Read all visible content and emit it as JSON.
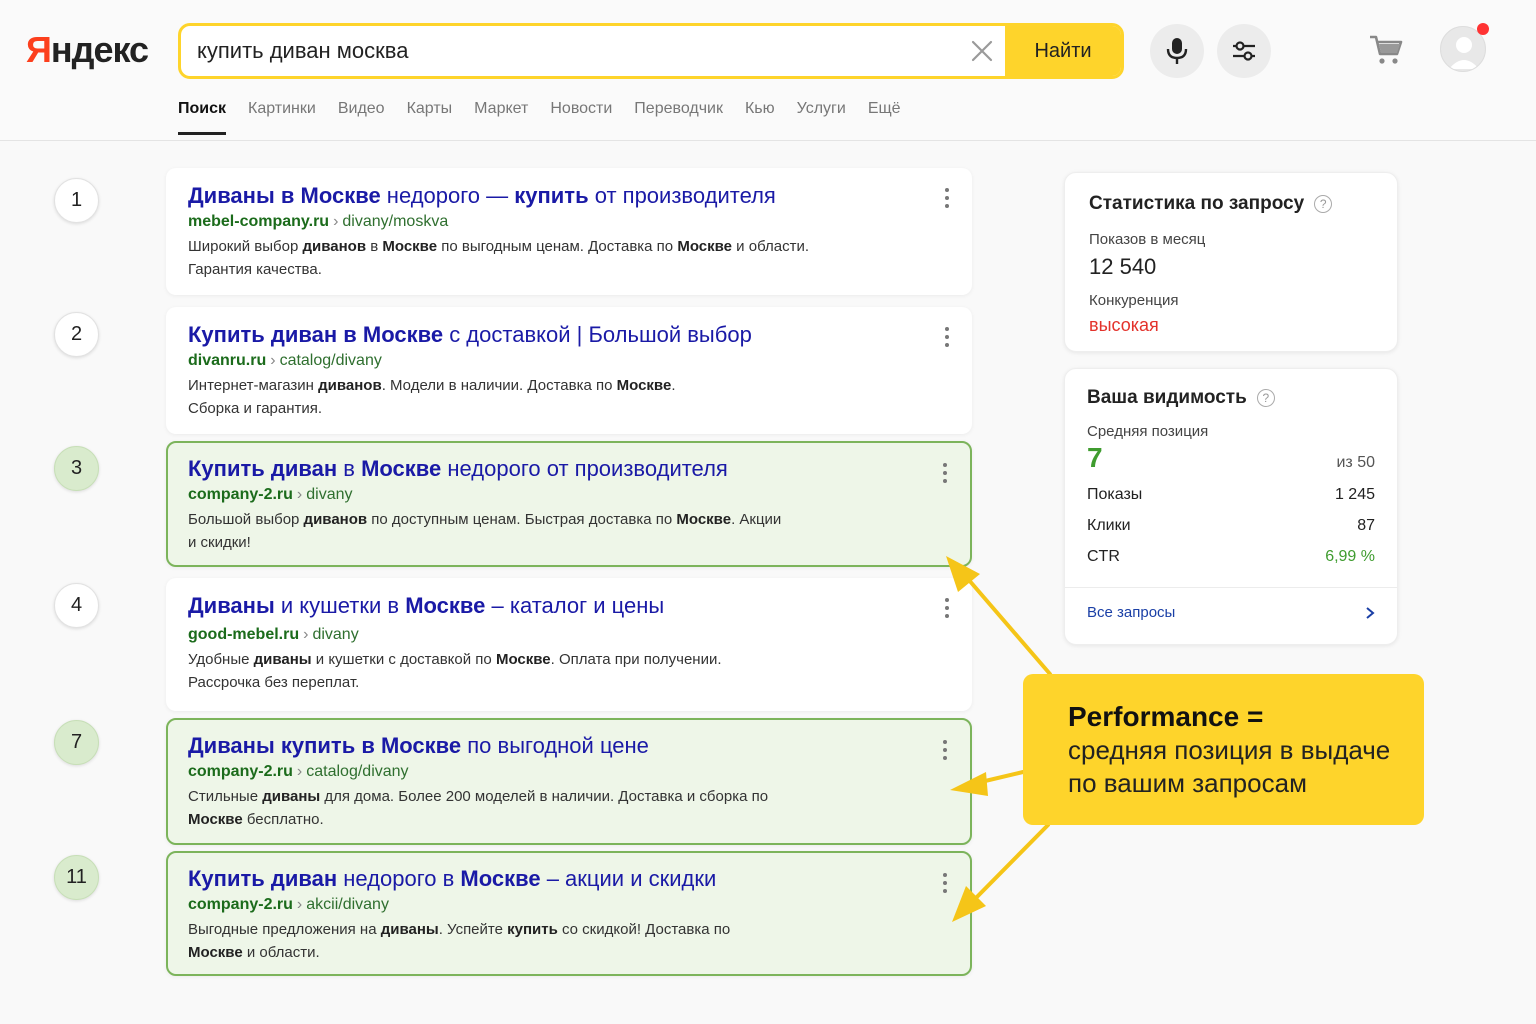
{
  "logo": {
    "first": "Я",
    "rest": "ндекс"
  },
  "search": {
    "query": "купить диван москва",
    "find_label": "Найти"
  },
  "tabs": [
    "Поиск",
    "Картинки",
    "Видео",
    "Карты",
    "Маркет",
    "Новости",
    "Переводчик",
    "Кью",
    "Услуги",
    "Ещё"
  ],
  "results": [
    {
      "position": "1",
      "own": false,
      "title": [
        {
          "t": "Диваны в Москве",
          "b": true
        },
        {
          "t": " недорого — ",
          "b": false
        },
        {
          "t": "купить",
          "b": true
        },
        {
          "t": " от производителя",
          "b": false
        }
      ],
      "domain": "mebel-company.ru",
      "sep": "›",
      "path": "divany/moskva",
      "snippet": [
        {
          "t": "Широкий выбор ",
          "b": false
        },
        {
          "t": "диванов",
          "b": true
        },
        {
          "t": " в ",
          "b": false
        },
        {
          "t": "Москве",
          "b": true
        },
        {
          "t": " по выгодным ценам. Доставка по ",
          "b": false
        },
        {
          "t": "Москве",
          "b": true
        },
        {
          "t": " и области. Гарантия качества.",
          "b": false
        }
      ]
    },
    {
      "position": "2",
      "own": false,
      "title": [
        {
          "t": "Купить диван в Москве",
          "b": true
        },
        {
          "t": " с доставкой | Большой выбор",
          "b": false
        }
      ],
      "domain": "divanru.ru",
      "sep": "›",
      "path": "catalog/divany",
      "snippet": [
        {
          "t": "Интернет-магазин ",
          "b": false
        },
        {
          "t": "диванов",
          "b": true
        },
        {
          "t": ". Модели в наличии. Доставка по ",
          "b": false
        },
        {
          "t": "Москве",
          "b": true
        },
        {
          "t": ". Сборка и гарантия.",
          "b": false
        }
      ]
    },
    {
      "position": "3",
      "own": true,
      "title": [
        {
          "t": "Купить диван",
          "b": true
        },
        {
          "t": " в ",
          "b": false
        },
        {
          "t": "Москве",
          "b": true
        },
        {
          "t": " недорого от производителя",
          "b": false
        }
      ],
      "domain": "company-2.ru",
      "sep": "›",
      "path": "divany",
      "snippet": [
        {
          "t": "Большой выбор ",
          "b": false
        },
        {
          "t": "диванов",
          "b": true
        },
        {
          "t": " по доступным ценам. Быстрая доставка по ",
          "b": false
        },
        {
          "t": "Москве",
          "b": true
        },
        {
          "t": ". Акции и скидки!",
          "b": false
        }
      ]
    },
    {
      "position": "4",
      "own": false,
      "title": [
        {
          "t": "Диваны",
          "b": true
        },
        {
          "t": " и кушетки в ",
          "b": false
        },
        {
          "t": "Москве",
          "b": true
        },
        {
          "t": " – каталог и цены",
          "b": false
        }
      ],
      "domain": "good-mebel.ru",
      "sep": "›",
      "path": "divany",
      "snippet": [
        {
          "t": "Удобные ",
          "b": false
        },
        {
          "t": "диваны",
          "b": true
        },
        {
          "t": " и кушетки с доставкой по ",
          "b": false
        },
        {
          "t": "Москве",
          "b": true
        },
        {
          "t": ". Оплата при получении. Рассрочка без переплат.",
          "b": false
        }
      ]
    },
    {
      "position": "7",
      "own": true,
      "title": [
        {
          "t": "Диваны купить в Москве",
          "b": true
        },
        {
          "t": " по выгодной цене",
          "b": false
        }
      ],
      "domain": "company-2.ru",
      "sep": "›",
      "path": "catalog/divany",
      "snippet": [
        {
          "t": "Стильные ",
          "b": false
        },
        {
          "t": "диваны",
          "b": true
        },
        {
          "t": " для дома. Более 200 моделей в наличии. Доставка и сборка по ",
          "b": false
        },
        {
          "t": "Москве",
          "b": true
        },
        {
          "t": " бесплатно.",
          "b": false
        }
      ]
    },
    {
      "position": "11",
      "own": true,
      "title": [
        {
          "t": "Купить диван",
          "b": true
        },
        {
          "t": " недорого в ",
          "b": false
        },
        {
          "t": "Москве",
          "b": true
        },
        {
          "t": " – акции и скидки",
          "b": false
        }
      ],
      "domain": "company-2.ru",
      "sep": "›",
      "path": "akcii/divany",
      "snippet": [
        {
          "t": "Выгодные предложения на ",
          "b": false
        },
        {
          "t": "диваны",
          "b": true
        },
        {
          "t": ". Успейте ",
          "b": false
        },
        {
          "t": "купить",
          "b": true
        },
        {
          "t": " со скидкой! Доставка по ",
          "b": false
        },
        {
          "t": "Москве",
          "b": true
        },
        {
          "t": " и области.",
          "b": false
        }
      ]
    }
  ],
  "stats": {
    "title": "Статистика по запросу",
    "shows_label": "Показов в месяц",
    "shows_value": "12 540",
    "competition_label": "Конкуренция",
    "competition_value": "высокая"
  },
  "visibility": {
    "title": "Ваша видимость",
    "avg_label": "Средняя позиция",
    "avg_value": "7",
    "avg_of": "из 50",
    "impressions_label": "Показы",
    "impressions_value": "1 245",
    "clicks_label": "Клики",
    "clicks_value": "87",
    "ctr_label": "CTR",
    "ctr_value": "6,99 %",
    "all_queries_label": "Все запросы"
  },
  "callout": {
    "title": "Performance =",
    "text": "средняя позиция в выдаче по вашим запросам"
  },
  "colors": {
    "accent_yellow": "#fed42b",
    "own_green": "#7cb45b",
    "link_blue": "#1a1aa6",
    "warning_red": "#e3322b",
    "ctr_green": "#3f9c2f"
  }
}
